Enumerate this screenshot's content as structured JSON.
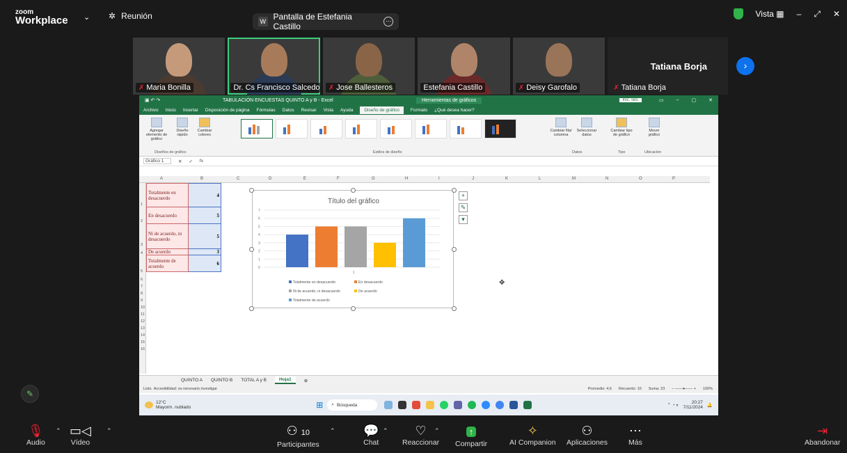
{
  "topbar": {
    "logo_line1": "zoom",
    "logo_line2": "Workplace",
    "meeting_label": "Reunión",
    "share_label": "Pantalla de Estefania Castillo",
    "view_label": "Vista"
  },
  "participants": [
    {
      "name": "Maria Bonilla"
    },
    {
      "name": "Dr. Cs Francisco Salcedo..."
    },
    {
      "name": "Jose Ballesteros"
    },
    {
      "name": "Estefania Castillo"
    },
    {
      "name": "Deisy Garofalo"
    },
    {
      "name": "Tatiana Borja",
      "big_name": "Tatiana Borja"
    }
  ],
  "excel": {
    "title": "TABULACIÓN ENCUESTAS QUINTO A y B  -  Excel",
    "context_tab": "Herramientas de gráficos",
    "signin": "Inic. ses.",
    "tabs": [
      "Archivo",
      "Inicio",
      "Insertar",
      "Disposición de página",
      "Fórmulas",
      "Datos",
      "Revisar",
      "Vista",
      "Ayuda",
      "Diseño de gráfico",
      "Formato",
      "¿Qué desea hacer?"
    ],
    "ribbon": {
      "add_element": "Agregar elemento de gráfico",
      "quick_layout": "Diseño rápido",
      "change_colors": "Cambiar colores",
      "group_layouts": "Diseños de gráfico",
      "group_styles": "Estilos de diseño",
      "switch_row_col": "Cambiar fila/ columna",
      "select_data": "Seleccionar datos",
      "group_data": "Datos",
      "change_type": "Cambiar tipo de gráfico",
      "group_type": "Tipo",
      "move_chart": "Mover gráfico",
      "group_location": "Ubicación"
    },
    "name_box": "Gráfico 1",
    "fx": "fx",
    "columns": [
      "A",
      "B",
      "C",
      "D",
      "E",
      "F",
      "G",
      "H",
      "I",
      "J",
      "K",
      "L",
      "M",
      "N",
      "O",
      "P"
    ],
    "rows": [
      "1",
      "2",
      "3",
      "4",
      "5",
      "6",
      "7",
      "8",
      "9",
      "10",
      "11",
      "12",
      "13",
      "14",
      "15",
      "16"
    ],
    "table": [
      {
        "label": "Totalmente en desacuerdo",
        "value": "4"
      },
      {
        "label": "En desacuerdo",
        "value": "5"
      },
      {
        "label": "Ni de acuerdo, ni desacuerdo",
        "value": "5"
      },
      {
        "label": "De acuerdo",
        "value": "3"
      },
      {
        "label": "Totalmente de acuerdo",
        "value": "6"
      }
    ],
    "sheet_tabs": [
      "QUINTO A",
      "QUINTO B",
      "TOTAL A y B",
      "Hoja1"
    ],
    "status_left": "Listo",
    "status_access": "Accesibilidad: es necesario investigar",
    "status_avg": "Promedio: 4,6",
    "status_count": "Recuento: 10",
    "status_sum": "Suma: 23",
    "zoom": "100%"
  },
  "chart_data": {
    "type": "bar",
    "title": "Título del gráfico",
    "categories": [
      "1"
    ],
    "series": [
      {
        "name": "Totalmente en desacuerdo",
        "values": [
          4
        ],
        "color": "#4472c4"
      },
      {
        "name": "En desacuerdo",
        "values": [
          5
        ],
        "color": "#ed7d31"
      },
      {
        "name": "Ni de acuerdo, ni desacuerdo",
        "values": [
          5
        ],
        "color": "#a5a5a5"
      },
      {
        "name": "De acuerdo",
        "values": [
          3
        ],
        "color": "#ffc000"
      },
      {
        "name": "Totalmente de acuerdo",
        "values": [
          6
        ],
        "color": "#5b9bd5"
      }
    ],
    "ylim": [
      0,
      7
    ],
    "yticks": [
      "0",
      "1",
      "2",
      "3",
      "4",
      "5",
      "6",
      "7"
    ],
    "grid": true,
    "legend_position": "bottom"
  },
  "taskbar": {
    "temp": "12°C",
    "weather": "Mayorm. nublado",
    "search": "Búsqueda",
    "time": "20:27",
    "date": "7/11/2024"
  },
  "toolbar": {
    "audio": "Audio",
    "video": "Vídeo",
    "participants": "Participantes",
    "participants_count": "10",
    "chat": "Chat",
    "react": "Reaccionar",
    "share": "Compartir",
    "companion": "AI Companion",
    "apps": "Aplicaciones",
    "more": "Más",
    "leave": "Abandonar"
  }
}
